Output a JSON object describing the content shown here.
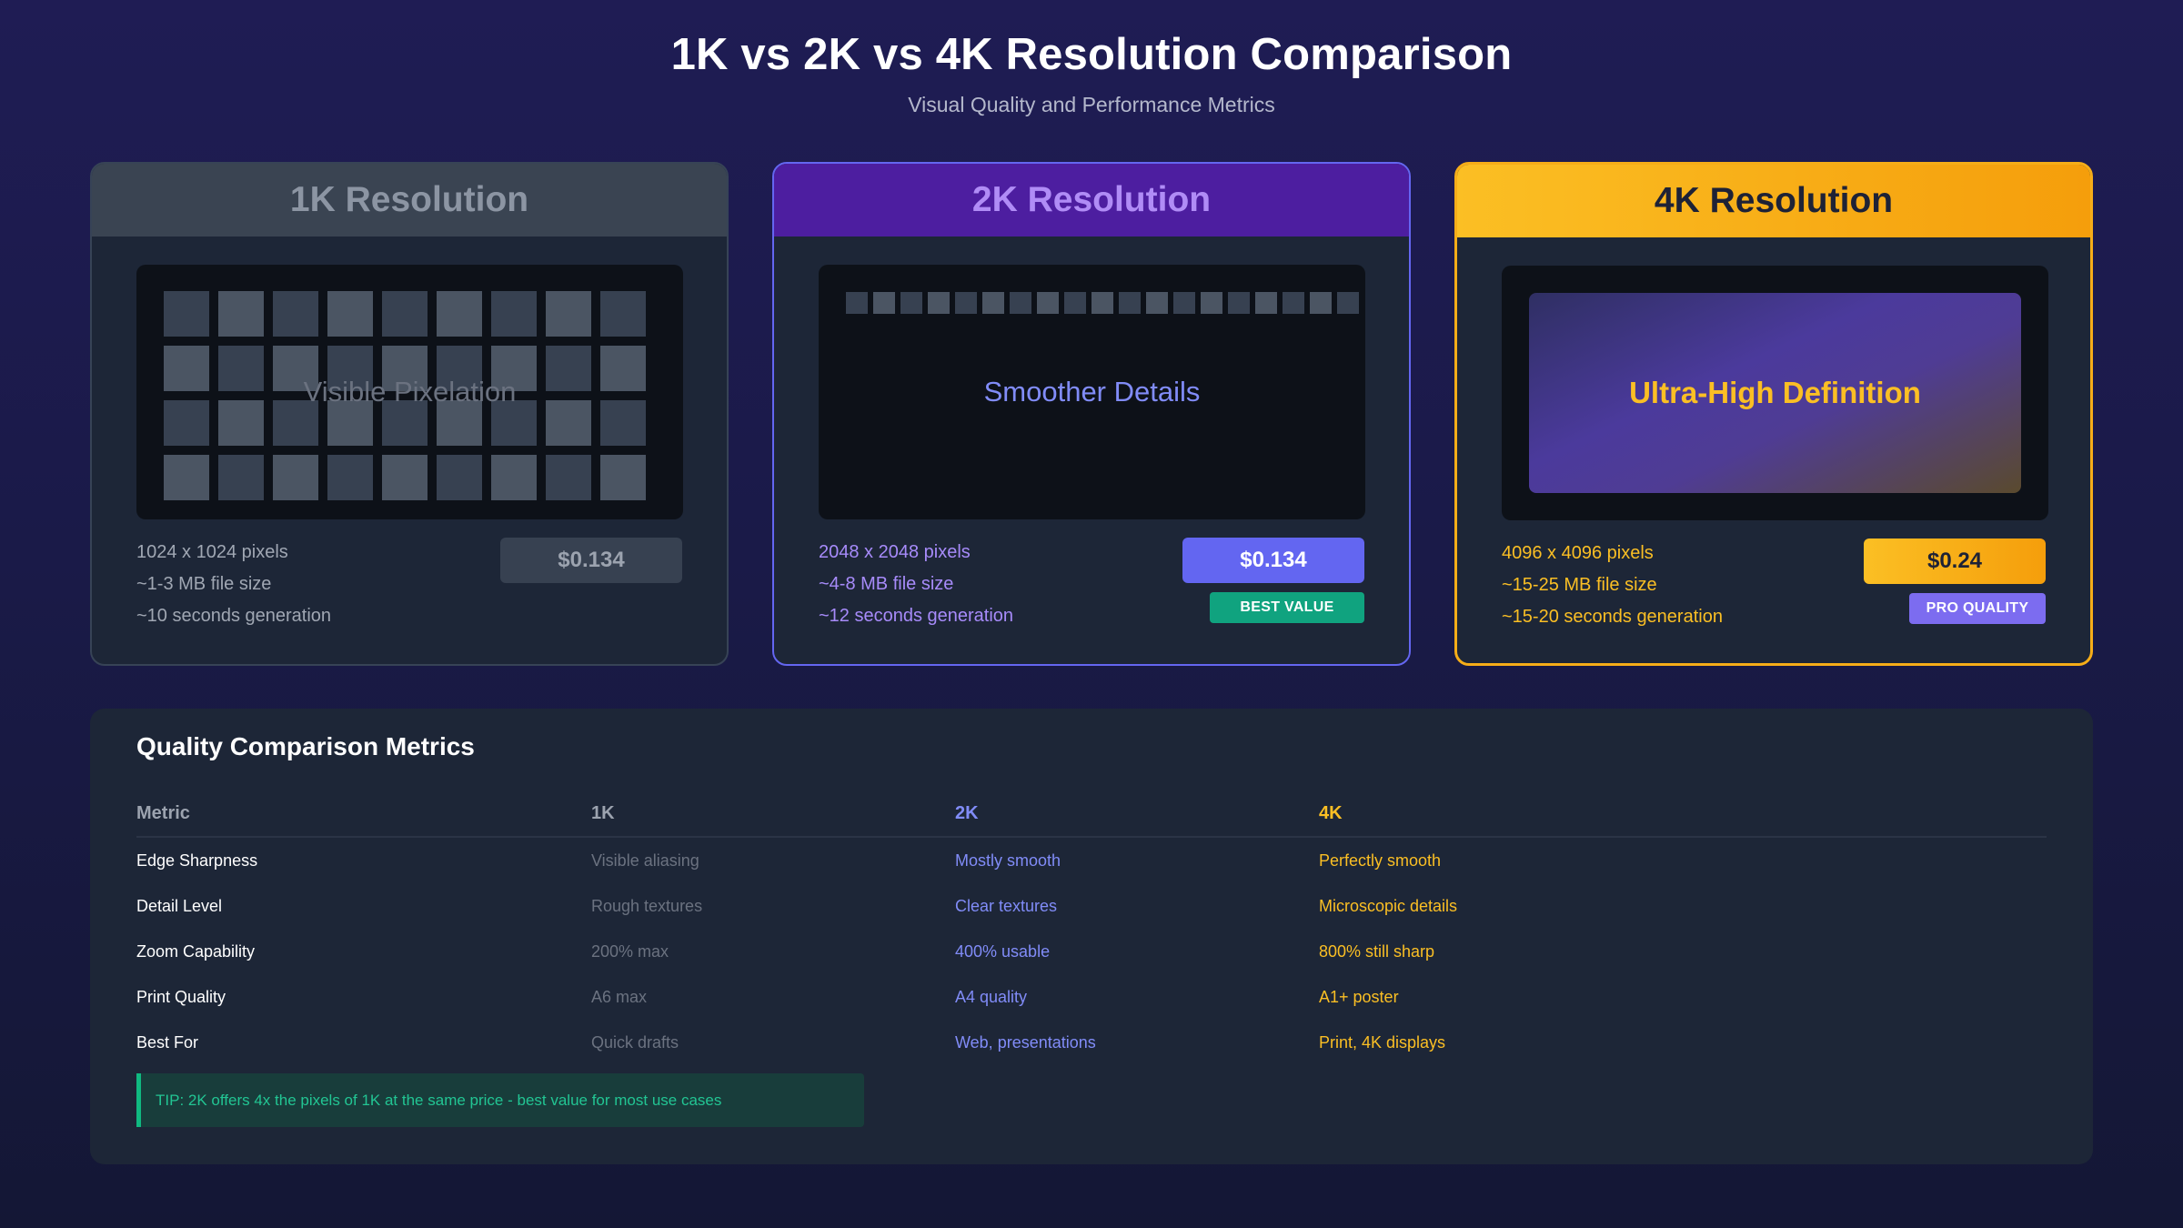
{
  "header": {
    "title": "1K vs 2K vs 4K Resolution Comparison",
    "subtitle": "Visual Quality and Performance Metrics"
  },
  "cards": [
    {
      "title": "1K Resolution",
      "preview_label": "Visible Pixelation",
      "specs": [
        "1024 x 1024 pixels",
        "~1-3 MB file size",
        "~10 seconds generation"
      ],
      "price": "$0.134",
      "badge": ""
    },
    {
      "title": "2K Resolution",
      "preview_label": "Smoother Details",
      "specs": [
        "2048 x 2048 pixels",
        "~4-8 MB file size",
        "~12 seconds generation"
      ],
      "price": "$0.134",
      "badge": "BEST VALUE"
    },
    {
      "title": "4K Resolution",
      "preview_label": "Ultra-High Definition",
      "specs": [
        "4096 x 4096 pixels",
        "~15-25 MB file size",
        "~15-20 seconds generation"
      ],
      "price": "$0.24",
      "badge": "PRO QUALITY"
    }
  ],
  "metrics": {
    "title": "Quality Comparison Metrics",
    "headers": [
      "Metric",
      "1K",
      "2K",
      "4K"
    ],
    "rows": [
      [
        "Edge Sharpness",
        "Visible aliasing",
        "Mostly smooth",
        "Perfectly smooth"
      ],
      [
        "Detail Level",
        "Rough textures",
        "Clear textures",
        "Microscopic details"
      ],
      [
        "Zoom Capability",
        "200% max",
        "400% usable",
        "800% still sharp"
      ],
      [
        "Print Quality",
        "A6 max",
        "A4 quality",
        "A1+ poster"
      ],
      [
        "Best For",
        "Quick drafts",
        "Web, presentations",
        "Print, 4K displays"
      ]
    ],
    "tip": "TIP: 2K offers 4x the pixels of 1K at the same price - best value for most use cases"
  },
  "colors": {
    "accent_2k": "#6366f1",
    "accent_4k": "#fbbf24",
    "tip_green": "#10b981",
    "panel_bg": "#1d2637"
  }
}
